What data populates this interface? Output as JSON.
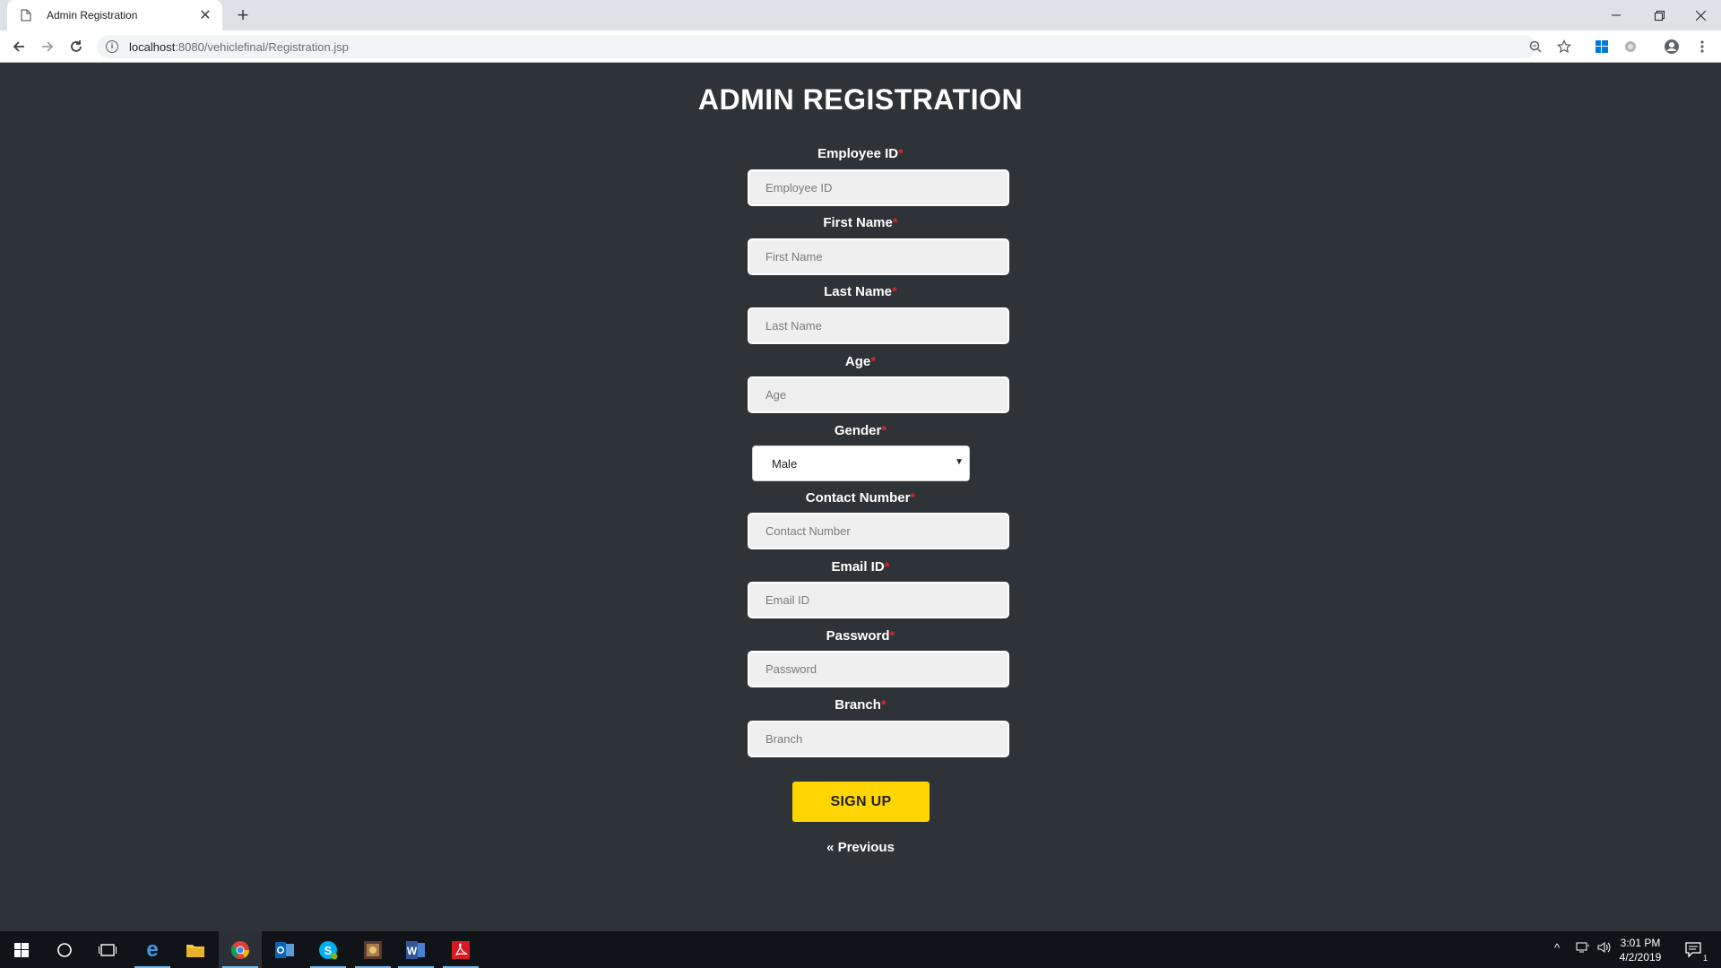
{
  "browser": {
    "tab_title": "Admin Registration",
    "url_host": "localhost",
    "url_path": ":8080/vehiclefinal/Registration.jsp"
  },
  "page": {
    "title": "ADMIN REGISTRATION",
    "required_marker": "*",
    "fields": {
      "employee_id": {
        "label": "Employee ID",
        "placeholder": "Employee ID"
      },
      "first_name": {
        "label": "First Name",
        "placeholder": "First Name"
      },
      "last_name": {
        "label": "Last Name",
        "placeholder": "Last Name"
      },
      "age": {
        "label": "Age",
        "placeholder": "Age"
      },
      "gender": {
        "label": "Gender",
        "selected": "Male"
      },
      "contact_number": {
        "label": "Contact Number",
        "placeholder": "Contact Number"
      },
      "email_id": {
        "label": "Email ID",
        "placeholder": "Email ID"
      },
      "password": {
        "label": "Password",
        "placeholder": "Password"
      },
      "branch": {
        "label": "Branch",
        "placeholder": "Branch"
      }
    },
    "signup_label": "SIGN UP",
    "previous_label": "« Previous"
  },
  "taskbar": {
    "time": "3:01 PM",
    "date": "4/2/2019",
    "notification_count": "1",
    "apps": [
      "start-icon",
      "search-icon",
      "task-view-icon",
      "edge-icon",
      "file-explorer-icon",
      "chrome-icon",
      "outlook-icon",
      "skype-icon",
      "app-icon",
      "word-icon",
      "acrobat-icon"
    ]
  },
  "colors": {
    "page_bg": "#2d3336",
    "accent_button": "#ffd600",
    "required": "#d9282f"
  }
}
